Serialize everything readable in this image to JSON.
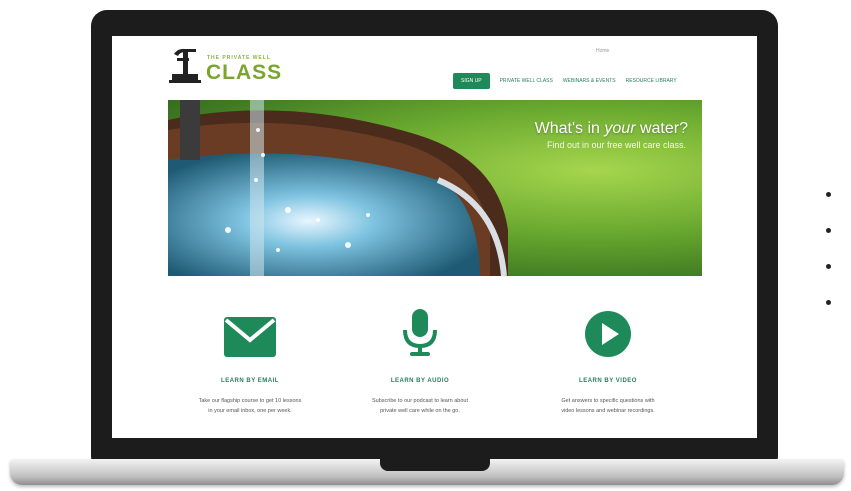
{
  "site": {
    "logo_small": "THE PRIVATE WELL",
    "logo_big": "CLASS",
    "top_link": "Home"
  },
  "nav": {
    "items": [
      {
        "label": "Sign up",
        "active": true
      },
      {
        "label": "Private Well Class",
        "active": false
      },
      {
        "label": "Webinars & Events",
        "active": false
      },
      {
        "label": "Resource Library",
        "active": false
      }
    ]
  },
  "hero": {
    "title_pre": "What's in ",
    "title_em": "your",
    "title_post": " water?",
    "subtitle": "Find out in our free well care class."
  },
  "features": [
    {
      "icon": "envelope-icon",
      "title": "Learn by email",
      "body": "Take our flagship course to get 10 lessons\nin your email inbox, one per week."
    },
    {
      "icon": "microphone-icon",
      "title": "Learn by audio",
      "body": "Subscribe to our podcast to learn about\nprivate well care while on the go."
    },
    {
      "icon": "play-icon",
      "title": "Learn by video",
      "body": "Get answers to specific questions with\nvideo lessons and webinar recordings."
    }
  ],
  "colors": {
    "brand_green": "#1e8a5a",
    "logo_green": "#7aa52e",
    "frame": "#1c1c1c"
  }
}
